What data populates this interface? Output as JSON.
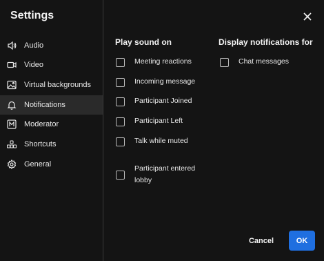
{
  "dialog": {
    "title": "Settings"
  },
  "sidebar": {
    "items": [
      {
        "label": "Audio",
        "icon": "speaker-icon"
      },
      {
        "label": "Video",
        "icon": "video-camera-icon"
      },
      {
        "label": "Virtual backgrounds",
        "icon": "image-icon"
      },
      {
        "label": "Notifications",
        "icon": "bell-icon",
        "active": true
      },
      {
        "label": "Moderator",
        "icon": "moderator-icon"
      },
      {
        "label": "Shortcuts",
        "icon": "shortcuts-icon"
      },
      {
        "label": "General",
        "icon": "gear-icon"
      }
    ]
  },
  "main": {
    "play_sound": {
      "title": "Play sound on",
      "options": [
        {
          "label": "Meeting reactions",
          "checked": false
        },
        {
          "label": "Incoming message",
          "checked": false
        },
        {
          "label": "Participant Joined",
          "checked": false
        },
        {
          "label": "Participant Left",
          "checked": false
        },
        {
          "label": "Talk while muted",
          "checked": false
        },
        {
          "label": "Participant entered lobby",
          "checked": false
        }
      ]
    },
    "display_notifications": {
      "title": "Display notifications for",
      "options": [
        {
          "label": "Chat messages",
          "checked": false
        }
      ]
    }
  },
  "footer": {
    "cancel_label": "Cancel",
    "ok_label": "OK"
  },
  "colors": {
    "background": "#141414",
    "active_item": "#2a2a2a",
    "accent": "#1f6fe0",
    "text": "#e8e8e8"
  }
}
